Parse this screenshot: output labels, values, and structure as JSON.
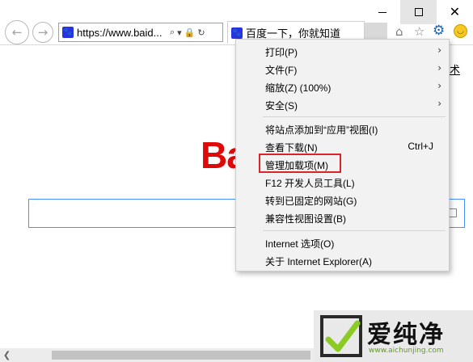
{
  "browser": {
    "address_text": "https://www.baid...",
    "tab_title": "百度一下，你就知道",
    "favicon_glyph": "🐾"
  },
  "page": {
    "top_right_link": "术",
    "logo_text": "Ba"
  },
  "tools_menu": {
    "items": [
      {
        "label": "打印(P)",
        "submenu": true
      },
      {
        "label": "文件(F)",
        "submenu": true
      },
      {
        "label": "缩放(Z) (100%)",
        "submenu": true
      },
      {
        "label": "安全(S)",
        "submenu": true
      },
      {
        "label": "将站点添加到“应用”视图(I)"
      },
      {
        "label": "查看下载(N)",
        "shortcut": "Ctrl+J"
      },
      {
        "label": "管理加载项(M)",
        "highlighted": true
      },
      {
        "label": "F12 开发人员工具(L)"
      },
      {
        "label": "转到已固定的网站(G)"
      },
      {
        "label": "兼容性视图设置(B)"
      },
      {
        "label": "Internet 选项(O)"
      },
      {
        "label": "关于 Internet Explorer(A)"
      }
    ]
  },
  "watermark": {
    "brand": "爱纯净",
    "url": "www.aichunjing.com"
  },
  "colors": {
    "highlight_border": "#d9252a",
    "logo_red": "#de0a0a",
    "search_border": "#4791ff",
    "ie_gear_blue": "#1b64b8"
  }
}
